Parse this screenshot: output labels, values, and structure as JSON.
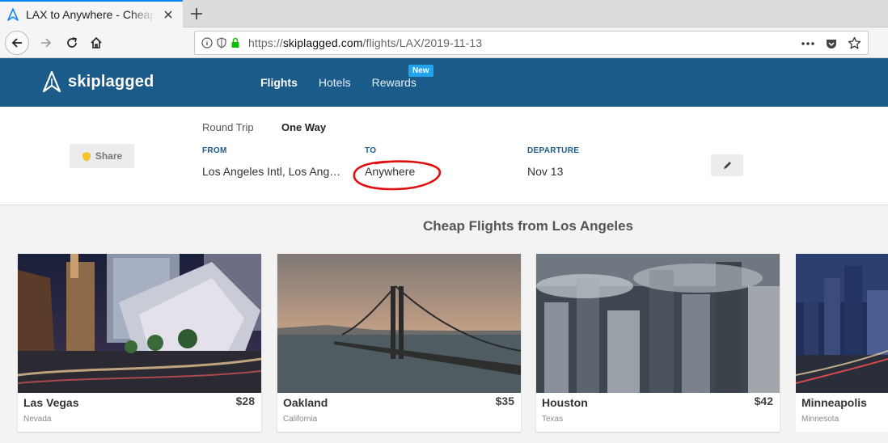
{
  "browser": {
    "tab_title": "LAX to Anywhere - Cheap Flights",
    "url_prefix": "https://",
    "url_domain": "skiplagged.com",
    "url_path": "/flights/LAX/2019-11-13"
  },
  "header": {
    "logo_text": "skiplagged",
    "nav": [
      "Flights",
      "Hotels",
      "Rewards"
    ],
    "new_badge": "New"
  },
  "search": {
    "trip_round": "Round Trip",
    "trip_oneway": "One Way",
    "share_label": "Share",
    "from_label": "FROM",
    "from_value": "Los Angeles Intl, Los Angeles",
    "to_label": "TO",
    "to_value": "Anywhere",
    "departure_label": "DEPARTURE",
    "departure_value": "Nov 13"
  },
  "main": {
    "title": "Cheap Flights from Los Angeles",
    "destinations": [
      {
        "city": "Las Vegas",
        "state": "Nevada",
        "price": "$28"
      },
      {
        "city": "Oakland",
        "state": "California",
        "price": "$35"
      },
      {
        "city": "Houston",
        "state": "Texas",
        "price": "$42"
      },
      {
        "city": "Minneapolis",
        "state": "Minnesota",
        "price": ""
      }
    ]
  },
  "colors": {
    "header_bg": "#1a5b8a",
    "accent": "#22a3ee",
    "annotation": "#e01010"
  }
}
